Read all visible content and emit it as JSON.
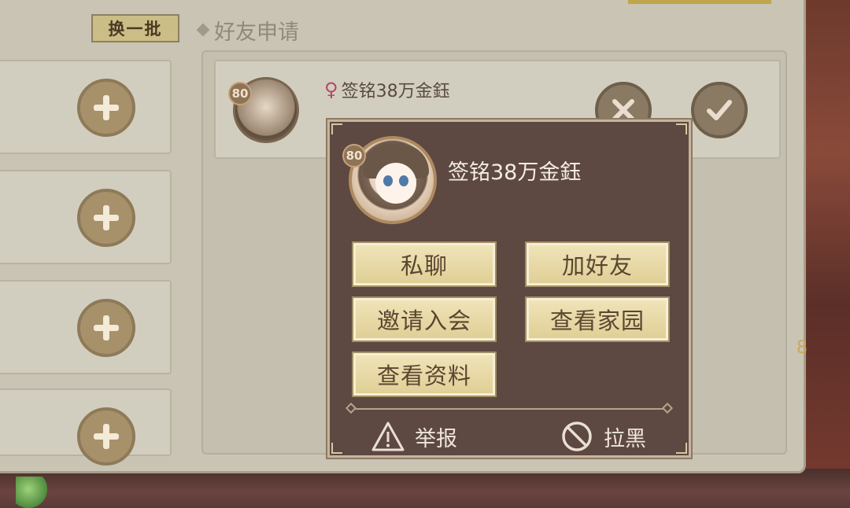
{
  "colors": {
    "popup_bg": "#5d4842",
    "button_face": "#e8d9a8",
    "button_text": "#5a4630",
    "panel_bg": "#c9c4b4",
    "female_symbol": "#b24a6a"
  },
  "header": {
    "refresh_label": "换一批",
    "section_title": "好友申请"
  },
  "recommend_list": {
    "items": [
      {
        "action_icon": "plus-icon"
      },
      {
        "action_icon": "plus-icon"
      },
      {
        "action_icon": "plus-icon"
      },
      {
        "action_icon": "plus-icon"
      }
    ]
  },
  "friend_request": {
    "level": "80",
    "gender_symbol": "♀",
    "name": "签铭38万金鈺",
    "reject_icon": "close-icon",
    "accept_icon": "check-icon"
  },
  "popup": {
    "level": "80",
    "name": "签铭38万金鈺",
    "buttons": {
      "private_chat": "私聊",
      "add_friend": "加好友",
      "invite_guild": "邀请入会",
      "view_home": "查看家园",
      "view_profile": "查看资料"
    },
    "footer": {
      "report": "举报",
      "block": "拉黑"
    }
  },
  "side_value": "8"
}
